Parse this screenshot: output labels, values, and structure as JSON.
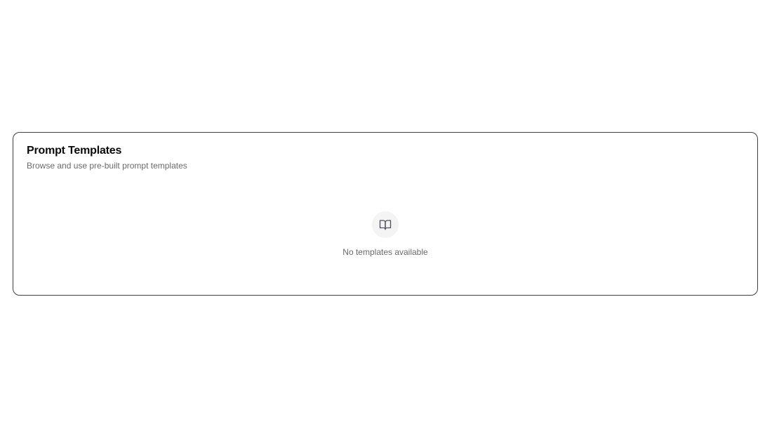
{
  "panel": {
    "title": "Prompt Templates",
    "subtitle": "Browse and use pre-built prompt templates"
  },
  "empty_state": {
    "icon": "book-open-icon",
    "message": "No templates available"
  },
  "colors": {
    "border": "#3f3f46",
    "title": "#0a0a0a",
    "muted_text": "#6b6b6b",
    "icon_bg": "#f4f4f5",
    "icon_stroke": "#52525b"
  }
}
